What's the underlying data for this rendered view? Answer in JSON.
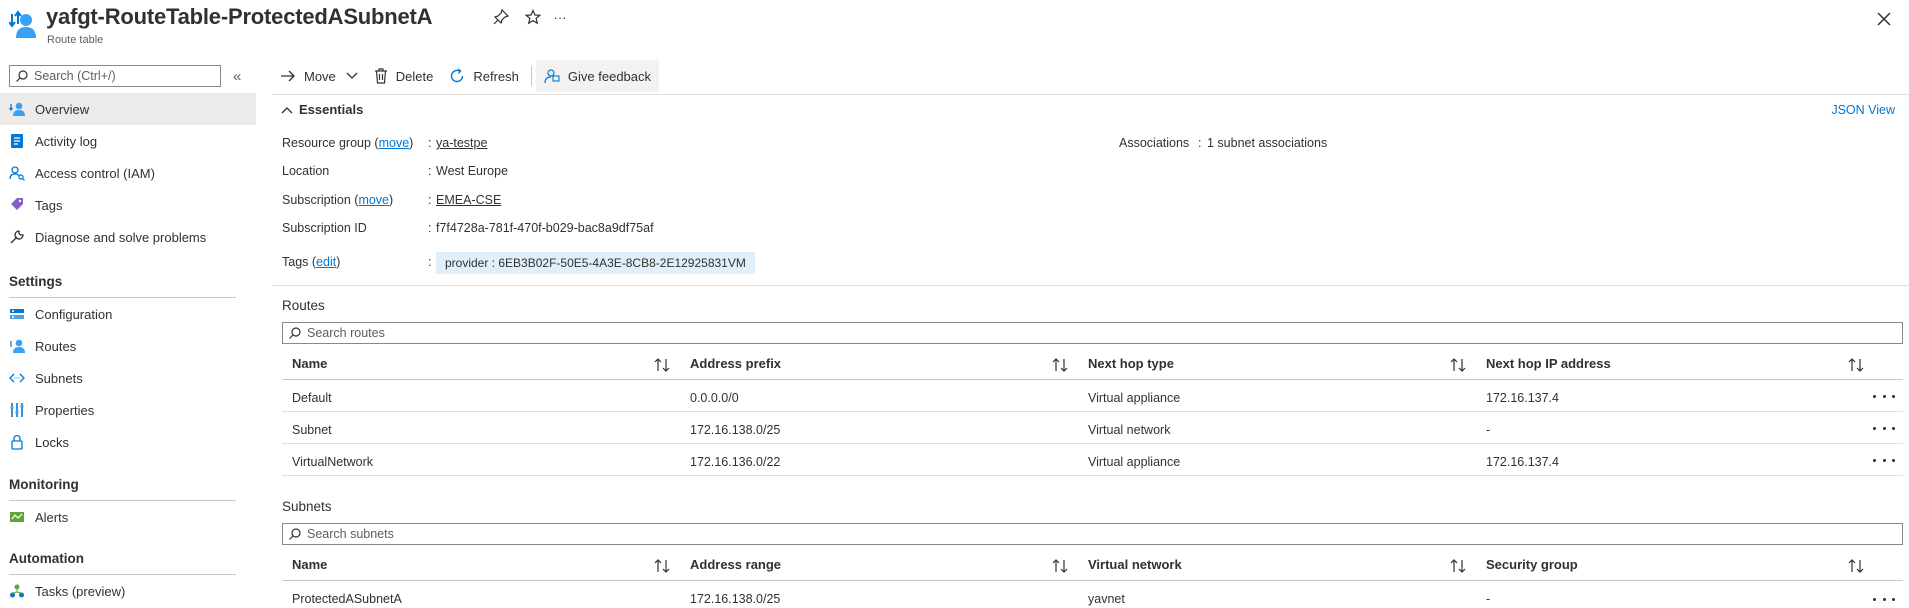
{
  "header": {
    "title": "yafgt-RouteTable-ProtectedASubnetA",
    "subtitle": "Route table",
    "more_label": "···"
  },
  "sidebar": {
    "search_placeholder": "Search (Ctrl+/)",
    "collapse_label": "«",
    "items": [
      {
        "label": "Overview",
        "icon": "route-table-icon"
      },
      {
        "label": "Activity log",
        "icon": "activity-log-icon"
      },
      {
        "label": "Access control (IAM)",
        "icon": "iam-icon"
      },
      {
        "label": "Tags",
        "icon": "tag-icon"
      },
      {
        "label": "Diagnose and solve problems",
        "icon": "wrench-icon"
      }
    ],
    "sections": [
      {
        "title": "Settings",
        "items": [
          {
            "label": "Configuration",
            "icon": "configuration-icon"
          },
          {
            "label": "Routes",
            "icon": "routes-icon"
          },
          {
            "label": "Subnets",
            "icon": "subnets-icon"
          },
          {
            "label": "Properties",
            "icon": "properties-icon"
          },
          {
            "label": "Locks",
            "icon": "lock-icon"
          }
        ]
      },
      {
        "title": "Monitoring",
        "items": [
          {
            "label": "Alerts",
            "icon": "alerts-icon"
          }
        ]
      },
      {
        "title": "Automation",
        "items": [
          {
            "label": "Tasks (preview)",
            "icon": "tasks-icon"
          }
        ]
      }
    ]
  },
  "toolbar": {
    "move": "Move",
    "delete": "Delete",
    "refresh": "Refresh",
    "feedback": "Give feedback"
  },
  "essentials": {
    "title": "Essentials",
    "json_view": "JSON View",
    "resource_group_label": "Resource group",
    "move_link": "move",
    "resource_group_value": "ya-testpe",
    "location_label": "Location",
    "location_value": "West Europe",
    "subscription_label": "Subscription",
    "subscription_value": "EMEA-CSE",
    "subscription_id_label": "Subscription ID",
    "subscription_id_value": "f7f4728a-781f-470f-b029-bac8a9df75af",
    "tags_label": "Tags",
    "edit_link": "edit",
    "tag_value": "provider : 6EB3B02F-50E5-4A3E-8CB8-2E12925831VM",
    "associations_label": "Associations",
    "associations_value": "1 subnet associations"
  },
  "routes": {
    "title": "Routes",
    "search_placeholder": "Search routes",
    "columns": [
      "Name",
      "Address prefix",
      "Next hop type",
      "Next hop IP address"
    ],
    "rows": [
      [
        "Default",
        "0.0.0.0/0",
        "Virtual appliance",
        "172.16.137.4"
      ],
      [
        "Subnet",
        "172.16.138.0/25",
        "Virtual network",
        "-"
      ],
      [
        "VirtualNetwork",
        "172.16.136.0/22",
        "Virtual appliance",
        "172.16.137.4"
      ]
    ]
  },
  "subnets": {
    "title": "Subnets",
    "search_placeholder": "Search subnets",
    "columns": [
      "Name",
      "Address range",
      "Virtual network",
      "Security group"
    ],
    "rows": [
      [
        "ProtectedASubnetA",
        "172.16.138.0/25",
        "yavnet",
        "-"
      ]
    ]
  },
  "colors": {
    "accent": "#0078d4",
    "selected_bg": "#edebe9",
    "tag_bg": "#e1effa"
  }
}
